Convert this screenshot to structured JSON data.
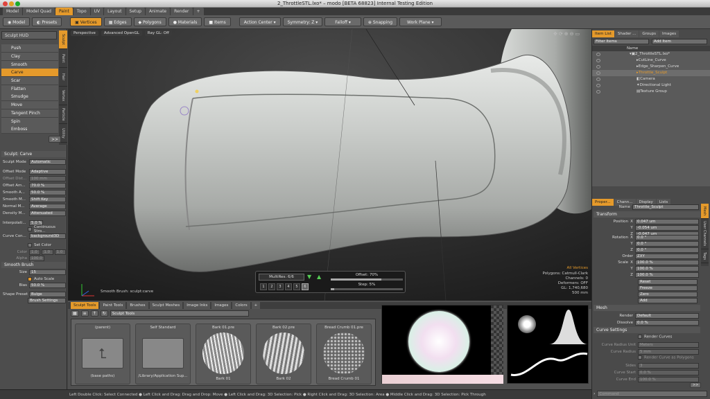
{
  "window": {
    "title": "2_ThrottleSTL.lxo* – modo [BETA 68823] Internal Testing Edition"
  },
  "layout_tabs": [
    "Model",
    "Model Quad",
    "Paint",
    "Topo",
    "UV",
    "Layout",
    "Setup",
    "Animate",
    "Render",
    "+"
  ],
  "active_layout_tab": "Paint",
  "toolbar": {
    "model": "Model",
    "presets": "Presets",
    "vertices": "Vertices",
    "edges": "Edges",
    "polygons": "Polygons",
    "materials": "Materials",
    "items": "Items",
    "action_center": "Action Center",
    "symmetry": "Symmetry: Z",
    "falloff": "Falloff",
    "snapping": "Snapping",
    "work_plane": "Work Plane"
  },
  "left": {
    "hud": "Sculpt HUD",
    "side_tabs": [
      "Sculpt",
      "Paint",
      "Hair",
      "Vertex Ma...",
      "Particle",
      "Utility"
    ],
    "brushes": [
      "Push",
      "Clay",
      "Smooth",
      "Carve",
      "Scar",
      "Flatten",
      "Smudge",
      "Move",
      "Tangent Pinch",
      "Spin",
      "Emboss"
    ],
    "selected_brush": "Carve",
    "more": ">>",
    "section_sculpt": "Sculpt: Carve",
    "props": [
      {
        "label": "Sculpt Mode",
        "value": "Automatic"
      },
      {
        "label": "Offset Mode",
        "value": "Adaptive"
      },
      {
        "label": "Offset Dist...",
        "value": "100 mm"
      },
      {
        "label": "Offset Am...",
        "value": "70.0 %"
      },
      {
        "label": "Smooth A...",
        "value": "50.0 %"
      },
      {
        "label": "Smooth M...",
        "value": "Shift Key"
      },
      {
        "label": "Normal M...",
        "value": "Average"
      },
      {
        "label": "Density M...",
        "value": "Attenuated"
      },
      {
        "label": "Interpolati...",
        "value": "5.0 %"
      }
    ],
    "continuous": "Continuous Stro...",
    "curve_con_label": "Curve Con...",
    "curve_con_value": "background3D",
    "set_color": "Set Color",
    "color_label": "Color",
    "color_values": [
      "1.0",
      "1.0",
      "1.0"
    ],
    "alpha_label": "Alpha",
    "alpha_value": "100.0 %",
    "section_smooth": "Smooth Brush",
    "size_label": "Size",
    "size_value": "15",
    "auto_scale": "Auto Scale",
    "bias_label": "Bias",
    "bias_value": "50.0 %",
    "shape_label": "Shape Preset",
    "shape_value": "Bulge",
    "brush_settings": "Brush Settings"
  },
  "viewport": {
    "tabs": [
      "Perspective",
      "Advanced OpenGL",
      "Ray GL: Off"
    ],
    "brush_label": "Smooth Brush: sculpt:carve",
    "info": [
      "All Vertices",
      "Polygons: Catmull-Clark",
      "Channels: 0",
      "Deformers: OFF",
      "GL: 1,740,680",
      "500 mm"
    ],
    "multires": "MultiRes: 6/6",
    "offset": "Offset: 70%",
    "step": "Step: 5%",
    "levels": [
      "1",
      "2",
      "3",
      "4",
      "5",
      "6"
    ]
  },
  "items": {
    "tabs": [
      "Item List",
      "Shader ...",
      "Groups",
      "Images"
    ],
    "filter": "Filter Items",
    "add": "Add Item",
    "col": "Name",
    "rows": [
      "2_ThrottleSTL.lxo*",
      "CutLine_Curve",
      "Edge_Sharpen_Curve",
      "Throttle_Sculpt",
      "Camera",
      "Directional Light",
      "Texture Group"
    ],
    "selected": "Throttle_Sculpt"
  },
  "properties": {
    "tabs": [
      "Proper...",
      "Chann...",
      "Display",
      "Lists"
    ],
    "name_label": "Name",
    "name_value": "Throttle_Sculpt",
    "transform": "Transform",
    "pos_label": "Position",
    "rot_label": "Rotation",
    "scale_label": "Scale",
    "order_label": "Order",
    "axes": [
      "X",
      "Y",
      "Z"
    ],
    "position": [
      "0.047 um",
      "-0.054 um",
      "-0.047 um"
    ],
    "rotation": [
      "0.0 °",
      "0.0 °",
      "0.0 °"
    ],
    "order": "ZXY",
    "scale": [
      "100.0 %",
      "100.0 %",
      "100.0 %"
    ],
    "actions": [
      "Reset",
      "Freeze",
      "Zero",
      "Add"
    ],
    "mesh": "Mesh",
    "render_label": "Render",
    "render_value": "Default",
    "dissolve_label": "Dissolve",
    "dissolve_value": "0.0 %",
    "curve_settings": "Curve Settings",
    "render_curves": "Render Curves",
    "curve_radius_unit_label": "Curve Radius Unit",
    "curve_radius_unit": "Meters",
    "curve_radius_label": "Curve Radius",
    "curve_radius": "5 mm",
    "render_as_poly": "Render Curve as Polygons",
    "sides_label": "Sides",
    "sides": "3",
    "curve_start_label": "Curve Start",
    "curve_start": "0.0 %",
    "curve_end_label": "Curve End",
    "curve_end": "100.0 %",
    "more": ">>",
    "command": "Command",
    "side_tabs": [
      "Mesh",
      "User Channels",
      "Tags"
    ]
  },
  "bottom": {
    "tabs": [
      "Sculpt Tools",
      "Paint Tools",
      "Brushes",
      "Sculpt Meshes",
      "Image Inks",
      "Images",
      "Colors",
      "+"
    ],
    "path": "Sculpt Tools",
    "presets": [
      {
        "title": "(parent)",
        "caption": "(base paths)"
      },
      {
        "title": "Self Standard",
        "caption": "/Library/Application Sup..."
      },
      {
        "title": "Bark 01.pre",
        "caption": "Bark 01"
      },
      {
        "title": "Bark 02.pre",
        "caption": "Bark 02"
      },
      {
        "title": "Bread Crumb 01.pre",
        "caption": "Bread Crumb 01"
      }
    ]
  },
  "status": "Left Double Click: Select Connected ● Left Click and Drag: Drag and Drop: Move ● Left Click and Drag: 3D Selection: Pick ● Right Click and Drag: 3D Selection: Area ● Middle Click and Drag: 3D Selection: Pick Through"
}
